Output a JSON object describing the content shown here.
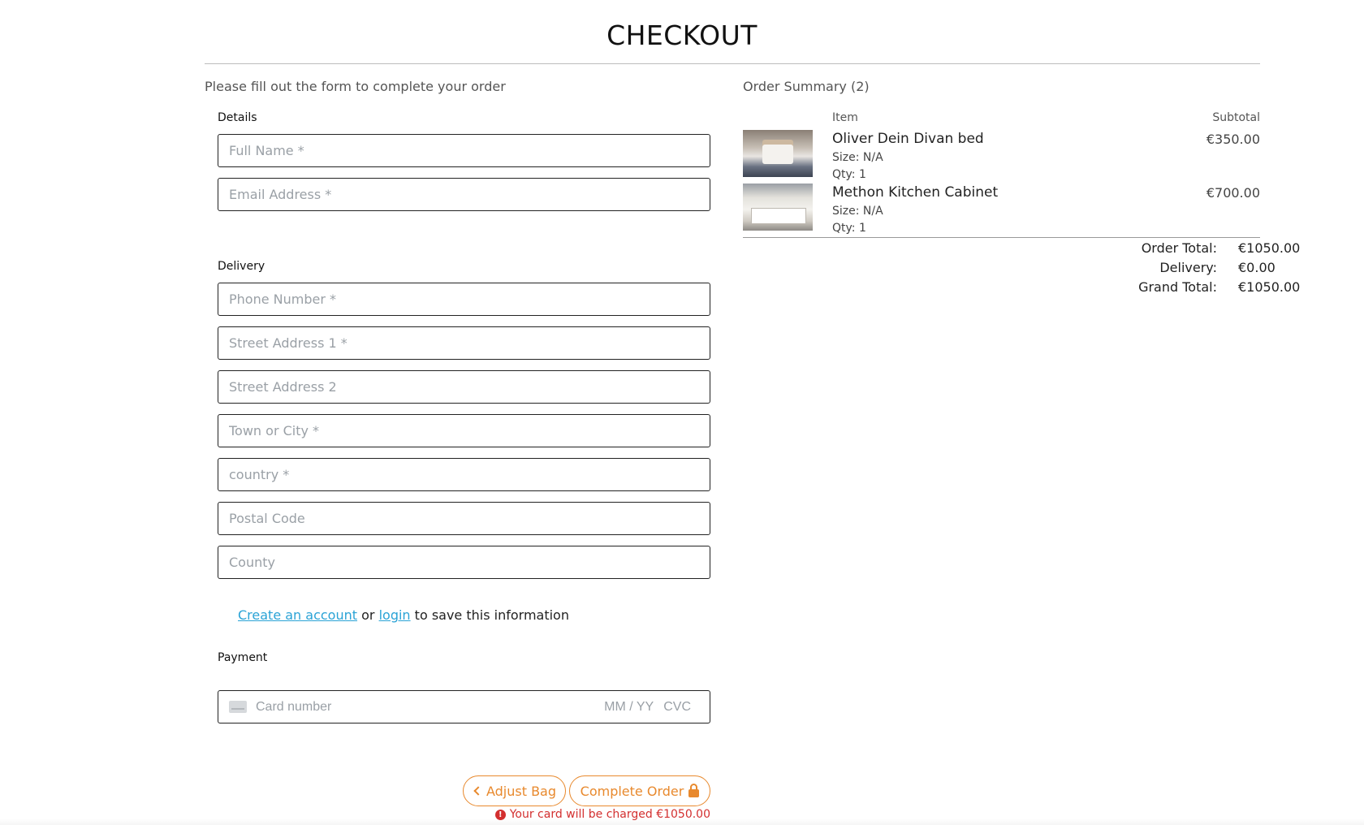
{
  "page": {
    "title": "CHECKOUT",
    "intro": "Please fill out the form to complete your order"
  },
  "form": {
    "details_label": "Details",
    "delivery_label": "Delivery",
    "payment_label": "Payment",
    "fields": {
      "full_name": "Full Name *",
      "email": "Email Address *",
      "phone": "Phone Number *",
      "street1": "Street Address 1 *",
      "street2": "Street Address 2",
      "town": "Town or City *",
      "country": "country *",
      "postcode": "Postal Code",
      "county": "County"
    },
    "save_info": {
      "create_link": "Create an account",
      "or_text": "or",
      "login_link": "login",
      "suffix": "to save this information"
    },
    "card": {
      "number_placeholder": "Card number",
      "expiry_placeholder": "MM / YY",
      "cvc_placeholder": "CVC",
      "icon": "card-icon"
    }
  },
  "actions": {
    "adjust_label": "Adjust Bag",
    "complete_label": "Complete Order",
    "charge_notice": "Your card will be charged €1050.00"
  },
  "summary": {
    "title": "Order Summary (2)",
    "col_item": "Item",
    "col_subtotal": "Subtotal",
    "items": [
      {
        "name": "Oliver Dein Divan bed",
        "size": "Size: N/A",
        "qty": "Qty: 1",
        "price": "€350.00"
      },
      {
        "name": "Methon Kitchen Cabinet",
        "size": "Size: N/A",
        "qty": "Qty: 1",
        "price": "€700.00"
      }
    ],
    "order_total_label": "Order Total:",
    "order_total": "€1050.00",
    "delivery_label": "Delivery:",
    "delivery": "€0.00",
    "grand_total_label": "Grand Total:",
    "grand_total": "€1050.00"
  },
  "colors": {
    "accent": "#e8892d",
    "link": "#2aa3d6",
    "error": "#d32f2f"
  }
}
